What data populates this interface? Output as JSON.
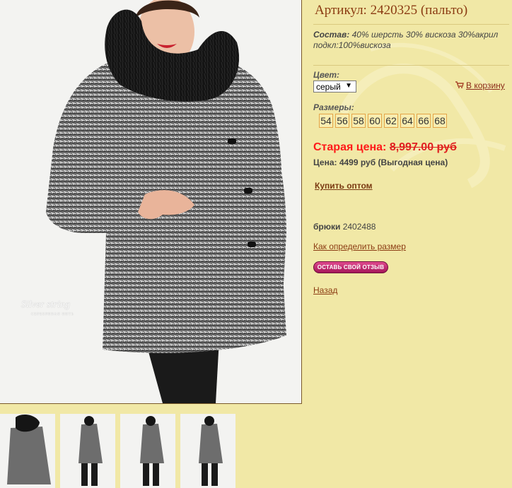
{
  "product": {
    "article_title": "Артикул: 2420325 (пальто)",
    "composition_label": "Состав:",
    "composition_text": " 40% шерсть 30% вискоза 30%акрил подкл:100%вискоза",
    "color_label": "Цвет:",
    "color_selected": "серый",
    "cart_label": "В корзину",
    "sizes_label": "Размеры:",
    "sizes": [
      "54",
      "56",
      "58",
      "60",
      "62",
      "64",
      "66",
      "68"
    ],
    "old_price_label": "Старая цена: ",
    "old_price_value": "8,997.00 руб",
    "price_text": "Цена: 4499 руб (Выгодная цена)",
    "wholesale_label": "Купить оптом",
    "pants_label": "брюки",
    "pants_code": " 2402488",
    "size_help_label": "Как определить размер",
    "review_button_label": "ОСТАВЬ СВОЙ ОТЗЫВ",
    "back_label": "Назад"
  },
  "photo": {
    "watermark_brand": "Silver string",
    "watermark_sub": "СЕРЕБРЯНАЯ НИТЬ"
  },
  "icons": {
    "cart": "shopping-cart-icon",
    "select_arrow": "chevron-down-icon"
  },
  "colors": {
    "page_bg": "#f1e8a6",
    "title": "#8b3b12",
    "old_price": "#ff1a1a",
    "review_button": "#c0286e",
    "size_border": "#e4a447"
  }
}
